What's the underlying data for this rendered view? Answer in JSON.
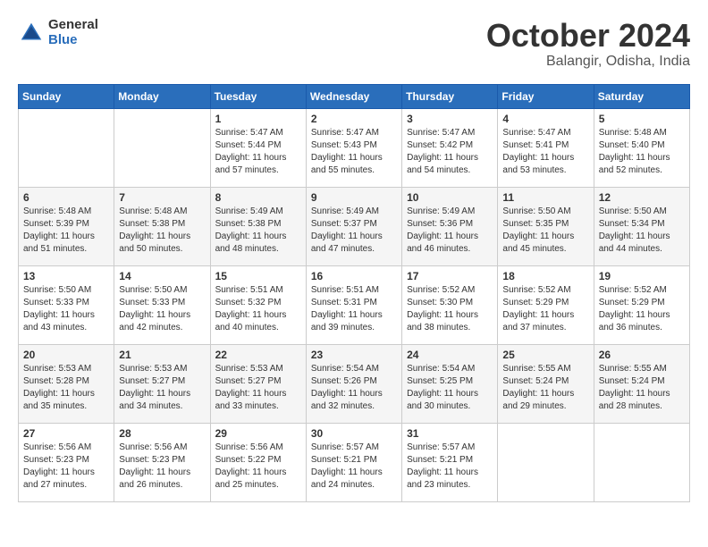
{
  "logo": {
    "general": "General",
    "blue": "Blue"
  },
  "title": "October 2024",
  "location": "Balangir, Odisha, India",
  "headers": [
    "Sunday",
    "Monday",
    "Tuesday",
    "Wednesday",
    "Thursday",
    "Friday",
    "Saturday"
  ],
  "weeks": [
    [
      {
        "day": "",
        "sunrise": "",
        "sunset": "",
        "daylight": ""
      },
      {
        "day": "",
        "sunrise": "",
        "sunset": "",
        "daylight": ""
      },
      {
        "day": "1",
        "sunrise": "Sunrise: 5:47 AM",
        "sunset": "Sunset: 5:44 PM",
        "daylight": "Daylight: 11 hours and 57 minutes."
      },
      {
        "day": "2",
        "sunrise": "Sunrise: 5:47 AM",
        "sunset": "Sunset: 5:43 PM",
        "daylight": "Daylight: 11 hours and 55 minutes."
      },
      {
        "day": "3",
        "sunrise": "Sunrise: 5:47 AM",
        "sunset": "Sunset: 5:42 PM",
        "daylight": "Daylight: 11 hours and 54 minutes."
      },
      {
        "day": "4",
        "sunrise": "Sunrise: 5:47 AM",
        "sunset": "Sunset: 5:41 PM",
        "daylight": "Daylight: 11 hours and 53 minutes."
      },
      {
        "day": "5",
        "sunrise": "Sunrise: 5:48 AM",
        "sunset": "Sunset: 5:40 PM",
        "daylight": "Daylight: 11 hours and 52 minutes."
      }
    ],
    [
      {
        "day": "6",
        "sunrise": "Sunrise: 5:48 AM",
        "sunset": "Sunset: 5:39 PM",
        "daylight": "Daylight: 11 hours and 51 minutes."
      },
      {
        "day": "7",
        "sunrise": "Sunrise: 5:48 AM",
        "sunset": "Sunset: 5:38 PM",
        "daylight": "Daylight: 11 hours and 50 minutes."
      },
      {
        "day": "8",
        "sunrise": "Sunrise: 5:49 AM",
        "sunset": "Sunset: 5:38 PM",
        "daylight": "Daylight: 11 hours and 48 minutes."
      },
      {
        "day": "9",
        "sunrise": "Sunrise: 5:49 AM",
        "sunset": "Sunset: 5:37 PM",
        "daylight": "Daylight: 11 hours and 47 minutes."
      },
      {
        "day": "10",
        "sunrise": "Sunrise: 5:49 AM",
        "sunset": "Sunset: 5:36 PM",
        "daylight": "Daylight: 11 hours and 46 minutes."
      },
      {
        "day": "11",
        "sunrise": "Sunrise: 5:50 AM",
        "sunset": "Sunset: 5:35 PM",
        "daylight": "Daylight: 11 hours and 45 minutes."
      },
      {
        "day": "12",
        "sunrise": "Sunrise: 5:50 AM",
        "sunset": "Sunset: 5:34 PM",
        "daylight": "Daylight: 11 hours and 44 minutes."
      }
    ],
    [
      {
        "day": "13",
        "sunrise": "Sunrise: 5:50 AM",
        "sunset": "Sunset: 5:33 PM",
        "daylight": "Daylight: 11 hours and 43 minutes."
      },
      {
        "day": "14",
        "sunrise": "Sunrise: 5:50 AM",
        "sunset": "Sunset: 5:33 PM",
        "daylight": "Daylight: 11 hours and 42 minutes."
      },
      {
        "day": "15",
        "sunrise": "Sunrise: 5:51 AM",
        "sunset": "Sunset: 5:32 PM",
        "daylight": "Daylight: 11 hours and 40 minutes."
      },
      {
        "day": "16",
        "sunrise": "Sunrise: 5:51 AM",
        "sunset": "Sunset: 5:31 PM",
        "daylight": "Daylight: 11 hours and 39 minutes."
      },
      {
        "day": "17",
        "sunrise": "Sunrise: 5:52 AM",
        "sunset": "Sunset: 5:30 PM",
        "daylight": "Daylight: 11 hours and 38 minutes."
      },
      {
        "day": "18",
        "sunrise": "Sunrise: 5:52 AM",
        "sunset": "Sunset: 5:29 PM",
        "daylight": "Daylight: 11 hours and 37 minutes."
      },
      {
        "day": "19",
        "sunrise": "Sunrise: 5:52 AM",
        "sunset": "Sunset: 5:29 PM",
        "daylight": "Daylight: 11 hours and 36 minutes."
      }
    ],
    [
      {
        "day": "20",
        "sunrise": "Sunrise: 5:53 AM",
        "sunset": "Sunset: 5:28 PM",
        "daylight": "Daylight: 11 hours and 35 minutes."
      },
      {
        "day": "21",
        "sunrise": "Sunrise: 5:53 AM",
        "sunset": "Sunset: 5:27 PM",
        "daylight": "Daylight: 11 hours and 34 minutes."
      },
      {
        "day": "22",
        "sunrise": "Sunrise: 5:53 AM",
        "sunset": "Sunset: 5:27 PM",
        "daylight": "Daylight: 11 hours and 33 minutes."
      },
      {
        "day": "23",
        "sunrise": "Sunrise: 5:54 AM",
        "sunset": "Sunset: 5:26 PM",
        "daylight": "Daylight: 11 hours and 32 minutes."
      },
      {
        "day": "24",
        "sunrise": "Sunrise: 5:54 AM",
        "sunset": "Sunset: 5:25 PM",
        "daylight": "Daylight: 11 hours and 30 minutes."
      },
      {
        "day": "25",
        "sunrise": "Sunrise: 5:55 AM",
        "sunset": "Sunset: 5:24 PM",
        "daylight": "Daylight: 11 hours and 29 minutes."
      },
      {
        "day": "26",
        "sunrise": "Sunrise: 5:55 AM",
        "sunset": "Sunset: 5:24 PM",
        "daylight": "Daylight: 11 hours and 28 minutes."
      }
    ],
    [
      {
        "day": "27",
        "sunrise": "Sunrise: 5:56 AM",
        "sunset": "Sunset: 5:23 PM",
        "daylight": "Daylight: 11 hours and 27 minutes."
      },
      {
        "day": "28",
        "sunrise": "Sunrise: 5:56 AM",
        "sunset": "Sunset: 5:23 PM",
        "daylight": "Daylight: 11 hours and 26 minutes."
      },
      {
        "day": "29",
        "sunrise": "Sunrise: 5:56 AM",
        "sunset": "Sunset: 5:22 PM",
        "daylight": "Daylight: 11 hours and 25 minutes."
      },
      {
        "day": "30",
        "sunrise": "Sunrise: 5:57 AM",
        "sunset": "Sunset: 5:21 PM",
        "daylight": "Daylight: 11 hours and 24 minutes."
      },
      {
        "day": "31",
        "sunrise": "Sunrise: 5:57 AM",
        "sunset": "Sunset: 5:21 PM",
        "daylight": "Daylight: 11 hours and 23 minutes."
      },
      {
        "day": "",
        "sunrise": "",
        "sunset": "",
        "daylight": ""
      },
      {
        "day": "",
        "sunrise": "",
        "sunset": "",
        "daylight": ""
      }
    ]
  ]
}
